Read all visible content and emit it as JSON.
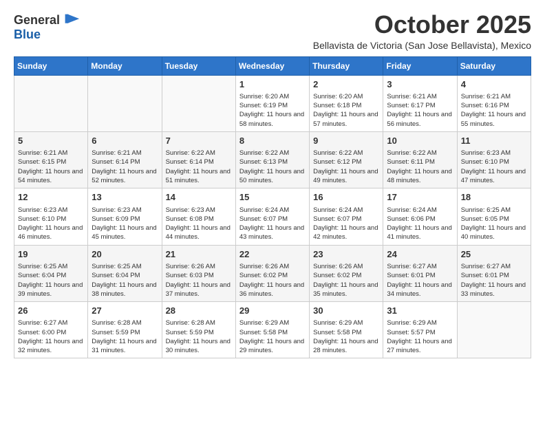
{
  "logo": {
    "line1": "General",
    "line2": "Blue"
  },
  "title": "October 2025",
  "subtitle": "Bellavista de Victoria (San Jose Bellavista), Mexico",
  "days_of_week": [
    "Sunday",
    "Monday",
    "Tuesday",
    "Wednesday",
    "Thursday",
    "Friday",
    "Saturday"
  ],
  "weeks": [
    [
      {
        "day": "",
        "sunrise": "",
        "sunset": "",
        "daylight": ""
      },
      {
        "day": "",
        "sunrise": "",
        "sunset": "",
        "daylight": ""
      },
      {
        "day": "",
        "sunrise": "",
        "sunset": "",
        "daylight": ""
      },
      {
        "day": "1",
        "sunrise": "Sunrise: 6:20 AM",
        "sunset": "Sunset: 6:19 PM",
        "daylight": "Daylight: 11 hours and 58 minutes."
      },
      {
        "day": "2",
        "sunrise": "Sunrise: 6:20 AM",
        "sunset": "Sunset: 6:18 PM",
        "daylight": "Daylight: 11 hours and 57 minutes."
      },
      {
        "day": "3",
        "sunrise": "Sunrise: 6:21 AM",
        "sunset": "Sunset: 6:17 PM",
        "daylight": "Daylight: 11 hours and 56 minutes."
      },
      {
        "day": "4",
        "sunrise": "Sunrise: 6:21 AM",
        "sunset": "Sunset: 6:16 PM",
        "daylight": "Daylight: 11 hours and 55 minutes."
      }
    ],
    [
      {
        "day": "5",
        "sunrise": "Sunrise: 6:21 AM",
        "sunset": "Sunset: 6:15 PM",
        "daylight": "Daylight: 11 hours and 54 minutes."
      },
      {
        "day": "6",
        "sunrise": "Sunrise: 6:21 AM",
        "sunset": "Sunset: 6:14 PM",
        "daylight": "Daylight: 11 hours and 52 minutes."
      },
      {
        "day": "7",
        "sunrise": "Sunrise: 6:22 AM",
        "sunset": "Sunset: 6:14 PM",
        "daylight": "Daylight: 11 hours and 51 minutes."
      },
      {
        "day": "8",
        "sunrise": "Sunrise: 6:22 AM",
        "sunset": "Sunset: 6:13 PM",
        "daylight": "Daylight: 11 hours and 50 minutes."
      },
      {
        "day": "9",
        "sunrise": "Sunrise: 6:22 AM",
        "sunset": "Sunset: 6:12 PM",
        "daylight": "Daylight: 11 hours and 49 minutes."
      },
      {
        "day": "10",
        "sunrise": "Sunrise: 6:22 AM",
        "sunset": "Sunset: 6:11 PM",
        "daylight": "Daylight: 11 hours and 48 minutes."
      },
      {
        "day": "11",
        "sunrise": "Sunrise: 6:23 AM",
        "sunset": "Sunset: 6:10 PM",
        "daylight": "Daylight: 11 hours and 47 minutes."
      }
    ],
    [
      {
        "day": "12",
        "sunrise": "Sunrise: 6:23 AM",
        "sunset": "Sunset: 6:10 PM",
        "daylight": "Daylight: 11 hours and 46 minutes."
      },
      {
        "day": "13",
        "sunrise": "Sunrise: 6:23 AM",
        "sunset": "Sunset: 6:09 PM",
        "daylight": "Daylight: 11 hours and 45 minutes."
      },
      {
        "day": "14",
        "sunrise": "Sunrise: 6:23 AM",
        "sunset": "Sunset: 6:08 PM",
        "daylight": "Daylight: 11 hours and 44 minutes."
      },
      {
        "day": "15",
        "sunrise": "Sunrise: 6:24 AM",
        "sunset": "Sunset: 6:07 PM",
        "daylight": "Daylight: 11 hours and 43 minutes."
      },
      {
        "day": "16",
        "sunrise": "Sunrise: 6:24 AM",
        "sunset": "Sunset: 6:07 PM",
        "daylight": "Daylight: 11 hours and 42 minutes."
      },
      {
        "day": "17",
        "sunrise": "Sunrise: 6:24 AM",
        "sunset": "Sunset: 6:06 PM",
        "daylight": "Daylight: 11 hours and 41 minutes."
      },
      {
        "day": "18",
        "sunrise": "Sunrise: 6:25 AM",
        "sunset": "Sunset: 6:05 PM",
        "daylight": "Daylight: 11 hours and 40 minutes."
      }
    ],
    [
      {
        "day": "19",
        "sunrise": "Sunrise: 6:25 AM",
        "sunset": "Sunset: 6:04 PM",
        "daylight": "Daylight: 11 hours and 39 minutes."
      },
      {
        "day": "20",
        "sunrise": "Sunrise: 6:25 AM",
        "sunset": "Sunset: 6:04 PM",
        "daylight": "Daylight: 11 hours and 38 minutes."
      },
      {
        "day": "21",
        "sunrise": "Sunrise: 6:26 AM",
        "sunset": "Sunset: 6:03 PM",
        "daylight": "Daylight: 11 hours and 37 minutes."
      },
      {
        "day": "22",
        "sunrise": "Sunrise: 6:26 AM",
        "sunset": "Sunset: 6:02 PM",
        "daylight": "Daylight: 11 hours and 36 minutes."
      },
      {
        "day": "23",
        "sunrise": "Sunrise: 6:26 AM",
        "sunset": "Sunset: 6:02 PM",
        "daylight": "Daylight: 11 hours and 35 minutes."
      },
      {
        "day": "24",
        "sunrise": "Sunrise: 6:27 AM",
        "sunset": "Sunset: 6:01 PM",
        "daylight": "Daylight: 11 hours and 34 minutes."
      },
      {
        "day": "25",
        "sunrise": "Sunrise: 6:27 AM",
        "sunset": "Sunset: 6:01 PM",
        "daylight": "Daylight: 11 hours and 33 minutes."
      }
    ],
    [
      {
        "day": "26",
        "sunrise": "Sunrise: 6:27 AM",
        "sunset": "Sunset: 6:00 PM",
        "daylight": "Daylight: 11 hours and 32 minutes."
      },
      {
        "day": "27",
        "sunrise": "Sunrise: 6:28 AM",
        "sunset": "Sunset: 5:59 PM",
        "daylight": "Daylight: 11 hours and 31 minutes."
      },
      {
        "day": "28",
        "sunrise": "Sunrise: 6:28 AM",
        "sunset": "Sunset: 5:59 PM",
        "daylight": "Daylight: 11 hours and 30 minutes."
      },
      {
        "day": "29",
        "sunrise": "Sunrise: 6:29 AM",
        "sunset": "Sunset: 5:58 PM",
        "daylight": "Daylight: 11 hours and 29 minutes."
      },
      {
        "day": "30",
        "sunrise": "Sunrise: 6:29 AM",
        "sunset": "Sunset: 5:58 PM",
        "daylight": "Daylight: 11 hours and 28 minutes."
      },
      {
        "day": "31",
        "sunrise": "Sunrise: 6:29 AM",
        "sunset": "Sunset: 5:57 PM",
        "daylight": "Daylight: 11 hours and 27 minutes."
      },
      {
        "day": "",
        "sunrise": "",
        "sunset": "",
        "daylight": ""
      }
    ]
  ]
}
